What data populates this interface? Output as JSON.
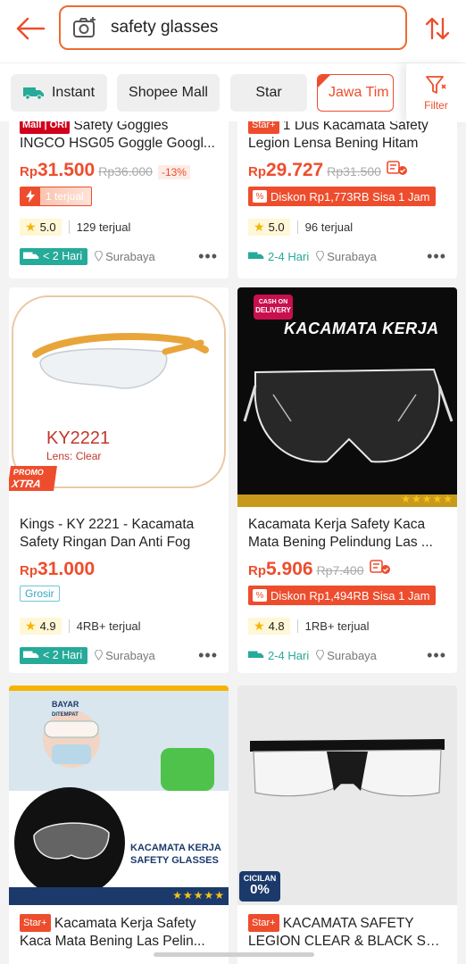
{
  "search": {
    "query": "safety glasses"
  },
  "filters": {
    "chips": [
      {
        "label": "Instant"
      },
      {
        "label": "Shopee Mall"
      },
      {
        "label": "Star"
      },
      {
        "label": "Jawa Tim"
      }
    ],
    "filter_label": "Filter"
  },
  "colors": {
    "accent": "#ee4d2d",
    "fast_shipping": "#26aa99",
    "rating_bg": "#fff7d6"
  },
  "products": [
    {
      "badge": "Mall | ORI",
      "title_l1": "Safety Goggles",
      "title_l2": "INGCO HSG05 Goggle Googl...",
      "currency": "Rp",
      "price": "31.500",
      "old_price": "Rp36.000",
      "discount": "-13%",
      "flash_label": "1 terjual",
      "rating": "5.0",
      "sold": "129 terjual",
      "shipping": "< 2 Hari",
      "location": "Surabaya"
    },
    {
      "badge": "Star+",
      "title_l1": "1 Dus Kacamata Safety",
      "title_l2": "Legion Lensa Bening Hitam",
      "currency": "Rp",
      "price": "29.727",
      "old_price": "Rp31.500",
      "discount_tag": "Diskon Rp1,773RB Sisa 1 Jam",
      "rating": "5.0",
      "sold": "96 terjual",
      "shipping": "2-4 Hari",
      "location": "Surabaya"
    },
    {
      "title_l1": "Kings - KY 2221 - Kacamata",
      "title_l2": "Safety Ringan Dan Anti Fog",
      "currency": "Rp",
      "price": "31.000",
      "tag": "Grosir",
      "rating": "4.9",
      "sold": "4RB+ terjual",
      "shipping": "< 2 Hari",
      "location": "Surabaya",
      "image_text": {
        "model": "KY2221",
        "lens": "Lens: Clear",
        "promo_top": "PROMO",
        "promo_bottom": "XTRA"
      }
    },
    {
      "title_l1": "Kacamata Kerja Safety Kaca",
      "title_l2": "Mata Bening Pelindung Las ...",
      "currency": "Rp",
      "price": "5.906",
      "old_price": "Rp7.400",
      "discount_tag": "Diskon Rp1,494RB Sisa 1 Jam",
      "rating": "4.8",
      "sold": "1RB+ terjual",
      "shipping": "2-4 Hari",
      "location": "Surabaya",
      "image_text": {
        "cod_top": "CASH ON",
        "cod_bottom": "DELIVERY",
        "headline": "KACAMATA KERJA"
      }
    },
    {
      "badge": "Star+",
      "title_l1": "Kacamata Kerja Safety",
      "title_l2": "Kaca Mata Bening Las Pelin...",
      "image_text": {
        "pay_top": "BAYAR",
        "pay_bottom": "DITEMPAT",
        "caption_l1": "KACAMATA KERJA",
        "caption_l2": "SAFETY GLASSES"
      }
    },
    {
      "badge": "Star+",
      "title_l1": "KACAMATA SAFETY",
      "title_l2": "LEGION CLEAR & BLACK SM...",
      "image_text": {
        "cicilan": "CICILAN",
        "cicilan_pct": "0%"
      }
    }
  ]
}
